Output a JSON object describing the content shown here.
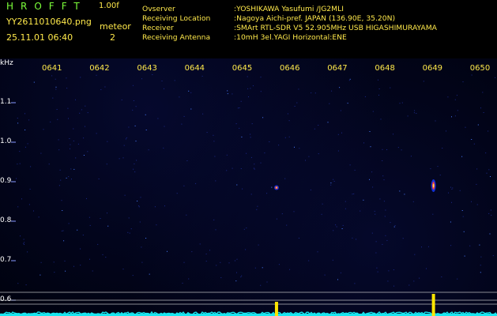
{
  "header": {
    "logo": "HROFFT",
    "version": "1.00f",
    "filename": "YY2611010640.png",
    "timestamp": "25.11.01 06:40",
    "meteor_label": "meteor",
    "meteor_count": "2"
  },
  "info": [
    {
      "key": "Ovserver",
      "value": ":YOSHIKAWA Yasufumi /JG2MLI"
    },
    {
      "key": "Receiving Location",
      "value": ":Nagoya Aichi-pref. JAPAN (136.90E, 35.20N)"
    },
    {
      "key": "Receiver",
      "value": ":SMArt RTL-SDR V5 52.905MHz USB HIGASHIMURAYAMA"
    },
    {
      "key": "Receiving Antenna",
      "value": ":10mH 3el.YAGI Horizontal:ENE"
    }
  ],
  "colors": {
    "logo": "#7CFF3A",
    "text": "#FFE94B",
    "spectrum": "#19E6F0",
    "meteor": "#FFE600",
    "background": "#00020f"
  },
  "chart_data": {
    "type": "heatmap",
    "ylabel": "kHz",
    "x_ticks": [
      "0641",
      "0642",
      "0643",
      "0644",
      "0645",
      "0646",
      "0647",
      "0648",
      "0649",
      "0650"
    ],
    "y_ticks": [
      "1.1",
      "1.0",
      "0.9",
      "0.8",
      "0.7",
      "0.6"
    ],
    "ylim": [
      0.58,
      1.2
    ],
    "xlim_minutes": [
      40.5,
      50.5
    ],
    "meteors": [
      {
        "minute": 45.7,
        "freq_khz": 0.885
      },
      {
        "minute": 49.0,
        "freq_khz": 0.89
      }
    ],
    "reference_lines_khz": [
      0.62,
      0.6,
      0.59
    ],
    "grid": false
  }
}
